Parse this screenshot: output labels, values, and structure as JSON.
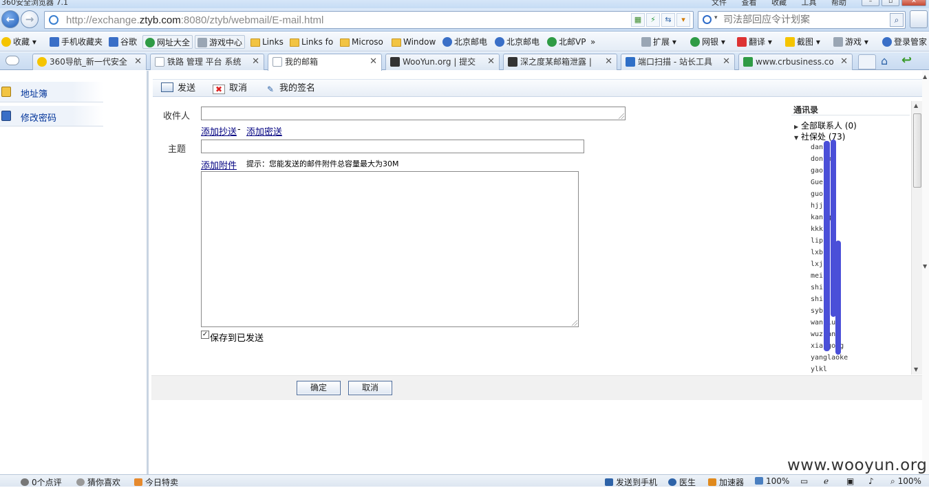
{
  "window": {
    "title": "360安全浏览器 7.1",
    "menus": [
      "文件",
      "查看",
      "收藏",
      "工具",
      "帮助"
    ]
  },
  "address_bar": {
    "url_scheme": "http://exchange.",
    "url_domain": "ztyb.com",
    "url_rest": ":8080/ztyb/webmail/E-mail.html"
  },
  "search": {
    "placeholder": "司法部回应令计划案"
  },
  "favorites": [
    {
      "label": "收藏",
      "icon": "star-icon"
    },
    {
      "label": "手机收藏夹",
      "icon": "phone-icon"
    },
    {
      "label": "谷歌",
      "icon": "google-icon"
    },
    {
      "label": "网址大全",
      "icon": "site-directory-icon"
    },
    {
      "label": "游戏中心",
      "icon": "gamepad-icon"
    },
    {
      "label": "Links",
      "icon": "folder-icon"
    },
    {
      "label": "Links fo",
      "icon": "folder-icon"
    },
    {
      "label": "Microso",
      "icon": "folder-icon"
    },
    {
      "label": "Window",
      "icon": "folder-icon"
    },
    {
      "label": "北京邮电",
      "icon": "globe-icon"
    },
    {
      "label": "北京邮电",
      "icon": "globe-icon"
    },
    {
      "label": "北邮VP",
      "icon": "globe-icon"
    },
    {
      "label": "»",
      "icon": "more-icon"
    }
  ],
  "toolbar_right": [
    {
      "label": "扩展",
      "icon": "extension-icon"
    },
    {
      "label": "网银",
      "icon": "bank-icon"
    },
    {
      "label": "翻译",
      "icon": "translate-icon"
    },
    {
      "label": "截图",
      "icon": "screenshot-icon"
    },
    {
      "label": "游戏",
      "icon": "game-icon"
    },
    {
      "label": "登录管家",
      "icon": "login-icon"
    }
  ],
  "tabs": [
    {
      "label": "360导航_新一代安全",
      "active": false,
      "icon_color": "#f5c400"
    },
    {
      "label": "铁路 管理 平台 系统",
      "active": false,
      "icon_color": "#c5ccd6"
    },
    {
      "label": "我的邮箱",
      "active": true,
      "icon_color": "#c5ccd6"
    },
    {
      "label": "WooYun.org | 提交",
      "active": false,
      "icon_color": "#333333"
    },
    {
      "label": "深之度某邮箱泄露 |",
      "active": false,
      "icon_color": "#333333"
    },
    {
      "label": "端口扫描 - 站长工具",
      "active": false,
      "icon_color": "#2f6fc7"
    },
    {
      "label": "www.crbusiness.co",
      "active": false,
      "icon_color": "#2f9b45"
    }
  ],
  "sidebar": {
    "items": [
      {
        "label": "地址簿",
        "icon": "address-book-icon"
      },
      {
        "label": "修改密码",
        "icon": "edit-password-icon"
      }
    ]
  },
  "mail_toolbar": {
    "send": "发送",
    "cancel": "取消",
    "signature": "我的签名"
  },
  "compose": {
    "to_label": "收件人",
    "to_value": "",
    "add_cc": "添加抄送",
    "separator": "-",
    "add_bcc": "添加密送",
    "subject_label": "主题",
    "subject_value": "",
    "add_attachment": "添加附件",
    "attachment_hint": "提示：您能发送的邮件附件总容量最大为30M",
    "body_value": "",
    "save_sent_label": "保存到已发送",
    "save_sent_checked": true
  },
  "contacts": {
    "title": "通讯录",
    "groups": [
      {
        "label": "全部联系人 (0)",
        "expanded": false
      },
      {
        "label": "社保处 (73)",
        "expanded": true
      }
    ],
    "names": [
      "dan",
      "don   o",
      "gao",
      "Gue",
      "guo",
      "hjj",
      "kan    g",
      "kkk",
      "lip",
      "lxb",
      "lxj",
      "mei",
      "shi",
      "shi  ",
      "syb",
      "wan      iu",
      "wuz      an",
      "xia      gong",
      "yanglaoke",
      "ylkl"
    ]
  },
  "footer": {
    "ok": "确定",
    "cancel": "取消"
  },
  "statusbar": {
    "comments": "0个点评",
    "guess": "猜你喜欢",
    "deals": "今日特卖",
    "send_phone": "发送到手机",
    "doctor": "医生",
    "accelerator": "加速器",
    "download_zoom": "100%",
    "zoom": "100%"
  },
  "watermark": "www.wooyun.org",
  "colors": {
    "link": "#000080",
    "sidebar_link": "#003399",
    "redaction": "#4a4fd8"
  }
}
